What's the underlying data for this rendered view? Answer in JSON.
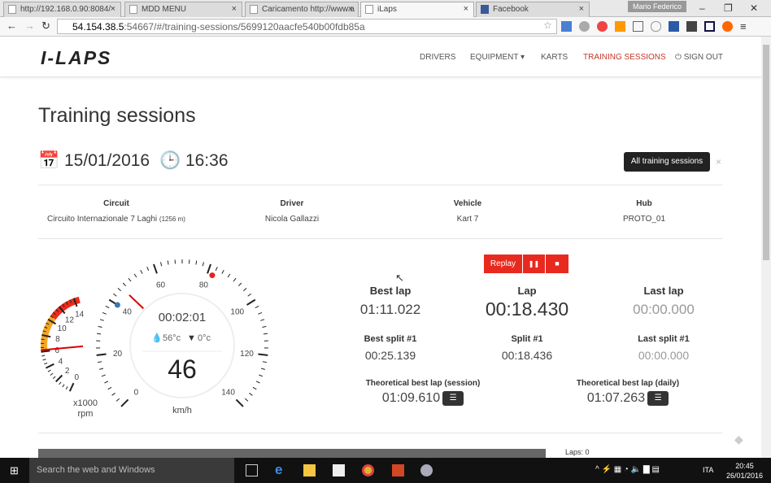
{
  "browser": {
    "tabs": [
      {
        "label": "http://192.168.0.90:8084/"
      },
      {
        "label": "MDD MENU"
      },
      {
        "label": "Caricamento http://www.a"
      },
      {
        "label": "iLaps",
        "active": true
      },
      {
        "label": "Facebook"
      }
    ],
    "user": "Mario Federico",
    "url_host": "54.154.38.5",
    "url_rest": ":54667/#/training-sessions/5699120aacfe540b00fdb85a"
  },
  "nav": {
    "logo": "I-LAPS",
    "items": [
      "DRIVERS",
      "EQUIPMENT ▾",
      "KARTS",
      "TRAINING SESSIONS",
      "⏻ SIGN OUT"
    ],
    "active": "TRAINING SESSIONS",
    "accent": "#c0392b"
  },
  "page": {
    "title": "Training sessions",
    "date": "15/01/2016",
    "time": "16:36",
    "all_sessions_button": "All training sessions",
    "close": "×",
    "info": [
      {
        "label": "Circuit",
        "value": "Circuito Internazionale 7 Laghi",
        "extra": "(1256 m)"
      },
      {
        "label": "Driver",
        "value": "Nicola Gallazzi"
      },
      {
        "label": "Vehicle",
        "value": "Kart 7"
      },
      {
        "label": "Hub",
        "value": "PROTO_01"
      }
    ],
    "controls": {
      "replay": "Replay",
      "pause": "❚❚",
      "stop": "■",
      "color": "#e8291f"
    },
    "gauge": {
      "elapsed": "00:02:01",
      "water_temp": "56°c",
      "exhaust_temp": "0°c",
      "speed": "46",
      "speed_unit": "km/h",
      "speed_value": 46,
      "speed_range": [
        0,
        140
      ],
      "speed_ticks": [
        "0",
        "20",
        "40",
        "60",
        "80",
        "100",
        "120",
        "140"
      ],
      "speed_min_marker": 40,
      "speed_max_marker": 82,
      "rpm_unit1": "x1000",
      "rpm_unit2": "rpm",
      "rpm_value": 6.2,
      "rpm_range": [
        0,
        14
      ],
      "rpm_ticks": [
        "0",
        "2",
        "4",
        "6",
        "8",
        "10",
        "12",
        "14"
      ]
    },
    "stats": {
      "best_lap": {
        "label": "Best lap",
        "value": "01:11.022"
      },
      "lap": {
        "label": "Lap",
        "value": "00:18.430"
      },
      "last_lap": {
        "label": "Last lap",
        "value": "00:00.000"
      },
      "best_split": {
        "label": "Best split #1",
        "value": "00:25.139"
      },
      "split": {
        "label": "Split #1",
        "value": "00:18.436"
      },
      "last_split": {
        "label": "Last split #1",
        "value": "00:00.000"
      },
      "theo_session": {
        "label": "Theoretical best lap (session)",
        "value": "01:09.610"
      },
      "theo_daily": {
        "label": "Theoretical best lap (daily)",
        "value": "01:07.263"
      }
    },
    "laps": "Laps: 0"
  },
  "taskbar": {
    "search": "Search the web and Windows",
    "lang": "ITA",
    "time": "20:45",
    "date": "26/01/2016"
  }
}
